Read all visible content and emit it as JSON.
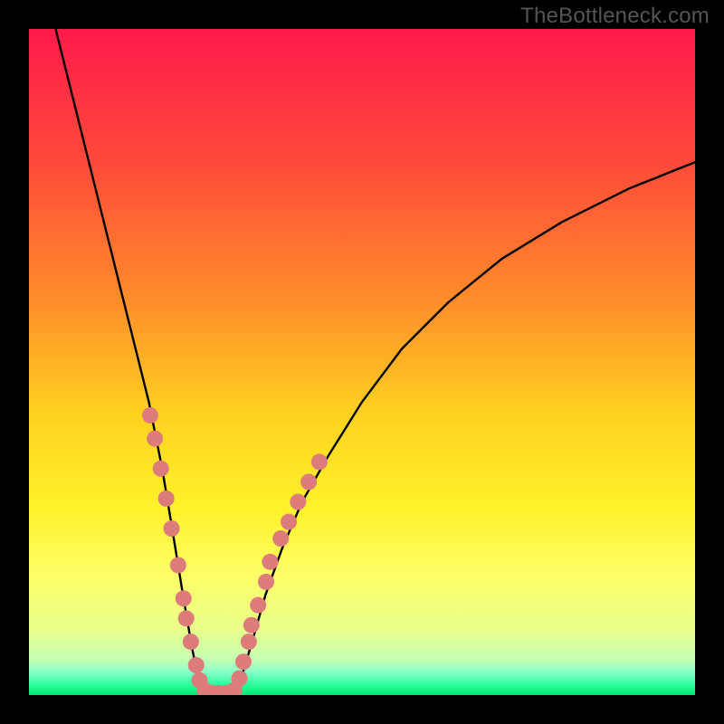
{
  "watermark": "TheBottleneck.com",
  "chart_data": {
    "type": "line",
    "title": "",
    "xlabel": "",
    "ylabel": "",
    "xlim": [
      0,
      100
    ],
    "ylim": [
      0,
      100
    ],
    "background_gradient": {
      "type": "vertical",
      "stops": [
        {
          "pos": 0.0,
          "color": "#ff1a4b"
        },
        {
          "pos": 0.2,
          "color": "#ff4a3a"
        },
        {
          "pos": 0.4,
          "color": "#ff8a2a"
        },
        {
          "pos": 0.58,
          "color": "#ffd21f"
        },
        {
          "pos": 0.72,
          "color": "#fff22a"
        },
        {
          "pos": 0.82,
          "color": "#fdff66"
        },
        {
          "pos": 0.9,
          "color": "#e9ff8a"
        },
        {
          "pos": 0.945,
          "color": "#c8ffb0"
        },
        {
          "pos": 0.965,
          "color": "#8affc8"
        },
        {
          "pos": 0.985,
          "color": "#2aff9a"
        },
        {
          "pos": 1.0,
          "color": "#00e873"
        }
      ]
    },
    "series": [
      {
        "name": "bottleneck-curve-left",
        "color": "#000000",
        "x": [
          4,
          6,
          8,
          10,
          12,
          14,
          16,
          18,
          20,
          21.5,
          22.8,
          23.8,
          24.6,
          25.2,
          25.6,
          26.0
        ],
        "y": [
          100,
          92,
          84,
          76,
          68,
          60,
          52,
          44,
          34,
          25,
          17,
          11,
          6.5,
          3.5,
          1.5,
          0.5
        ]
      },
      {
        "name": "bottleneck-curve-floor",
        "color": "#000000",
        "x": [
          26.0,
          27.0,
          28.0,
          29.0,
          30.0,
          30.8
        ],
        "y": [
          0.5,
          0.2,
          0.15,
          0.15,
          0.2,
          0.5
        ]
      },
      {
        "name": "bottleneck-curve-right",
        "color": "#000000",
        "x": [
          30.8,
          32,
          33.5,
          35.5,
          38,
          41,
          45,
          50,
          56,
          63,
          71,
          80,
          90,
          100
        ],
        "y": [
          0.5,
          3,
          8,
          15,
          22,
          29,
          36,
          44,
          52,
          59,
          65.5,
          71,
          76,
          80
        ]
      }
    ],
    "markers": {
      "name": "highlight-dots",
      "color": "#de7b7b",
      "radius_px": 9,
      "points": [
        {
          "x": 18.2,
          "y": 42
        },
        {
          "x": 18.9,
          "y": 38.5
        },
        {
          "x": 19.8,
          "y": 34
        },
        {
          "x": 20.6,
          "y": 29.5
        },
        {
          "x": 21.4,
          "y": 25
        },
        {
          "x": 22.4,
          "y": 19.5
        },
        {
          "x": 23.2,
          "y": 14.5
        },
        {
          "x": 23.6,
          "y": 11.5
        },
        {
          "x": 24.3,
          "y": 8
        },
        {
          "x": 25.1,
          "y": 4.5
        },
        {
          "x": 25.6,
          "y": 2.2
        },
        {
          "x": 26.4,
          "y": 0.7
        },
        {
          "x": 27.5,
          "y": 0.3
        },
        {
          "x": 28.6,
          "y": 0.3
        },
        {
          "x": 29.7,
          "y": 0.3
        },
        {
          "x": 30.8,
          "y": 0.7
        },
        {
          "x": 31.6,
          "y": 2.5
        },
        {
          "x": 32.2,
          "y": 5
        },
        {
          "x": 33.0,
          "y": 8
        },
        {
          "x": 33.4,
          "y": 10.5
        },
        {
          "x": 34.4,
          "y": 13.5
        },
        {
          "x": 35.6,
          "y": 17
        },
        {
          "x": 36.2,
          "y": 20
        },
        {
          "x": 37.8,
          "y": 23.5
        },
        {
          "x": 39.0,
          "y": 26
        },
        {
          "x": 40.4,
          "y": 29
        },
        {
          "x": 42.0,
          "y": 32
        },
        {
          "x": 43.6,
          "y": 35
        }
      ]
    }
  }
}
